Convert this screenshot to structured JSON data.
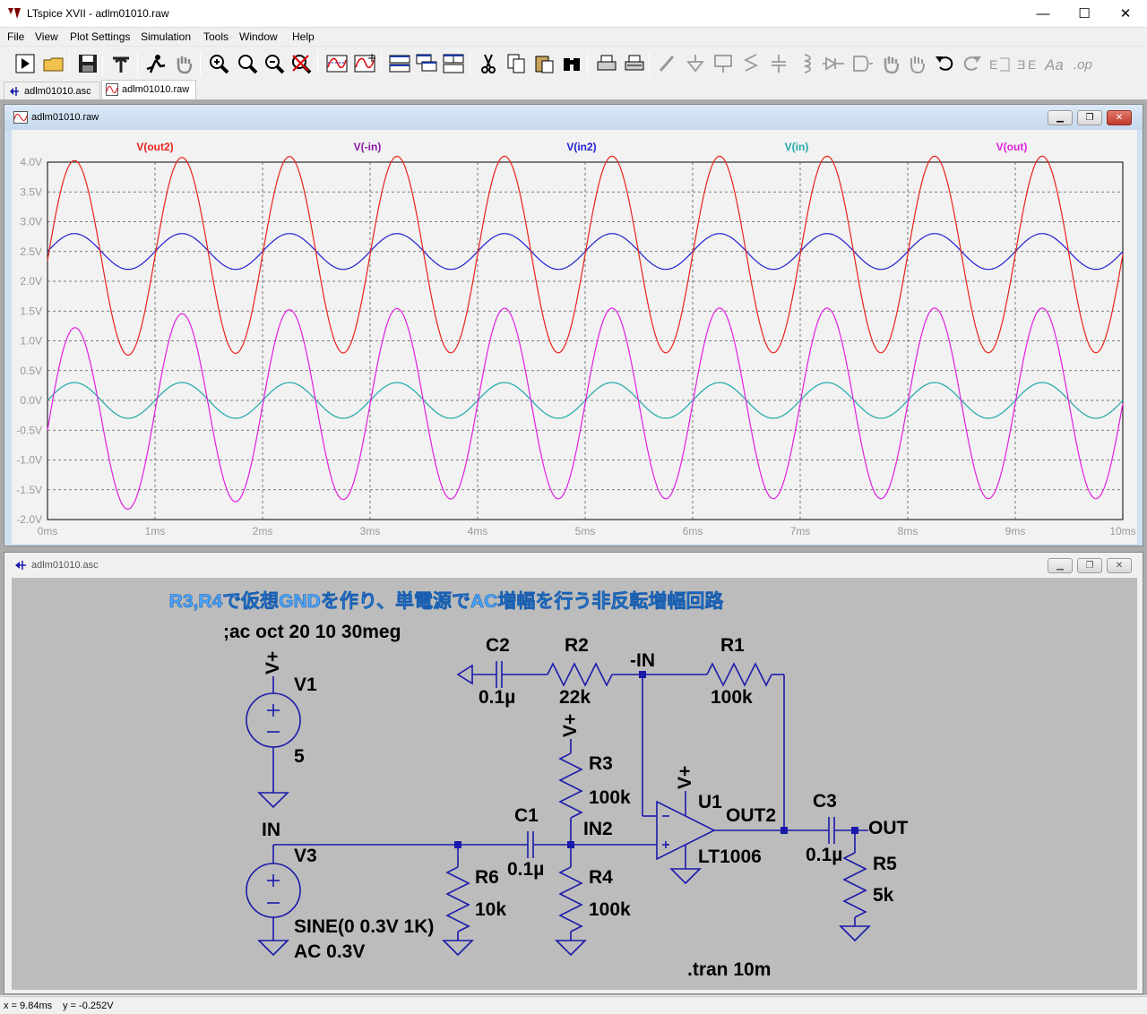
{
  "window": {
    "title": "LTspice XVII - adlm01010.raw",
    "min_symbol": "—",
    "max_symbol": "☐",
    "close_symbol": "✕"
  },
  "menu": [
    "File",
    "View",
    "Plot Settings",
    "Simulation",
    "Tools",
    "Window",
    "Help"
  ],
  "toolbar_icons": [
    "run-icon",
    "open-icon",
    "save-icon",
    "control-panel-icon",
    "run-stop-icon",
    "pan-hand-icon",
    "zoom-in-icon",
    "zoom-area-icon",
    "zoom-out-icon",
    "zoom-cancel-icon",
    "autorange-icon",
    "plot-icon",
    "tile-horizontal-icon",
    "cascade-icon",
    "tile-icon",
    "cut-icon",
    "copy-icon",
    "paste-icon",
    "find-icon",
    "print-icon",
    "print-preview-icon",
    "draw-wire-icon",
    "ground-icon",
    "label-net-icon",
    "resistor-icon",
    "capacitor-icon",
    "inductor-icon",
    "diode-icon",
    "component-icon",
    "move-icon",
    "drag-icon",
    "undo-icon",
    "redo-icon",
    "rotate-icon",
    "mirror-icon",
    "text-icon",
    "spice-directive-icon"
  ],
  "tabs": [
    {
      "label": "adlm01010.asc",
      "active": false
    },
    {
      "label": "adlm01010.raw",
      "active": true
    }
  ],
  "plot_window": {
    "title": "adlm01010.raw"
  },
  "schematic_window": {
    "title": "adlm01010.asc"
  },
  "chart_data": {
    "type": "line",
    "title": "",
    "xlabel": "",
    "ylabel": "",
    "xlim": [
      0,
      10
    ],
    "ylim": [
      -2.0,
      4.0
    ],
    "x_ticks": [
      "0ms",
      "1ms",
      "2ms",
      "3ms",
      "4ms",
      "5ms",
      "6ms",
      "7ms",
      "8ms",
      "9ms",
      "10ms"
    ],
    "y_ticks": [
      "4.0V",
      "3.5V",
      "3.0V",
      "2.5V",
      "2.0V",
      "1.5V",
      "1.0V",
      "0.5V",
      "0.0V",
      "-0.5V",
      "-1.0V",
      "-1.5V",
      "-2.0V"
    ],
    "grid": true,
    "legend_position": "top",
    "frequency_khz": 1,
    "series": [
      {
        "name": "V(out2)",
        "color": "#e8231a",
        "offset": 2.45,
        "amplitude": 1.65,
        "phase_deg": 0,
        "start_transient": -0.1
      },
      {
        "name": "V(-in)",
        "color": "#8a1aa8",
        "offset": 2.5,
        "amplitude": 0.3,
        "phase_deg": 0,
        "hidden_under": "V(in2)"
      },
      {
        "name": "V(in2)",
        "color": "#2020d0",
        "offset": 2.5,
        "amplitude": 0.3,
        "phase_deg": 0
      },
      {
        "name": "V(in)",
        "color": "#20a8a8",
        "offset": 0.0,
        "amplitude": 0.3,
        "phase_deg": 0
      },
      {
        "name": "V(out)",
        "color": "#e020e0",
        "offset": -0.05,
        "amplitude": 1.6,
        "phase_deg": 0,
        "start_transient": -0.45
      }
    ]
  },
  "schematic": {
    "heading": "R3,R4で仮想GNDを作り、単電源でAC増幅を行う非反転増幅回路",
    "ac_directive": ";ac oct 20 10 30meg",
    "tran_directive": ".tran 10m",
    "v1": {
      "name": "V1",
      "value": "5",
      "node": "V+"
    },
    "v3": {
      "name": "V3",
      "value1": "SINE(0 0.3V 1K)",
      "value2": "AC 0.3V",
      "node": "IN"
    },
    "c2": {
      "name": "C2",
      "value": "0.1µ"
    },
    "r2": {
      "name": "R2",
      "value": "22k"
    },
    "r1": {
      "name": "R1",
      "value": "100k"
    },
    "minus_in": "-IN",
    "r3": {
      "name": "R3",
      "value": "100k",
      "node": "V+"
    },
    "r4": {
      "name": "R4",
      "value": "100k"
    },
    "r6": {
      "name": "R6",
      "value": "10k"
    },
    "c1": {
      "name": "C1",
      "value": "0.1µ"
    },
    "in2": "IN2",
    "u1": {
      "name": "U1",
      "value": "LT1006",
      "node": "V+"
    },
    "out2": "OUT2",
    "c3": {
      "name": "C3",
      "value": "0.1µ"
    },
    "out": "OUT",
    "r5": {
      "name": "R5",
      "value": "5k"
    }
  },
  "status": {
    "x": "x = 9.84ms",
    "y": "y = -0.252V"
  },
  "colors": {
    "wire": "#1a1aaa",
    "component": "#1a1aaa",
    "heading_fill": "#4ea7ff",
    "plot_bg": "#f2f2f2",
    "schematic_bg": "#bcbcbc"
  }
}
